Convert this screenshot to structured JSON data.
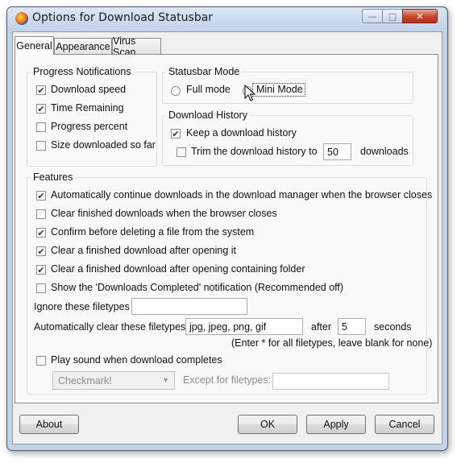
{
  "window": {
    "title": "Options for Download Statusbar",
    "caption_buttons": {
      "minimize": "—",
      "maximize": "□",
      "close": "✕"
    }
  },
  "tabs": [
    {
      "label": "General",
      "selected": true
    },
    {
      "label": "Appearance",
      "selected": false
    },
    {
      "label": "Virus Scan",
      "selected": false
    }
  ],
  "progress_notifications": {
    "legend": "Progress Notifications",
    "items": [
      {
        "label": "Download speed",
        "checked": true
      },
      {
        "label": "Time Remaining",
        "checked": true
      },
      {
        "label": "Progress percent",
        "checked": false
      },
      {
        "label": "Size downloaded so far",
        "checked": false
      }
    ]
  },
  "statusbar_mode": {
    "legend": "Statusbar Mode",
    "options": [
      {
        "label": "Full mode",
        "selected": false
      },
      {
        "label": "Mini Mode",
        "selected": true
      }
    ]
  },
  "download_history": {
    "legend": "Download History",
    "keep": {
      "label": "Keep a download history",
      "checked": true
    },
    "trim": {
      "label": "Trim the download history to",
      "checked": false,
      "value": "50",
      "suffix": "downloads"
    }
  },
  "features": {
    "legend": "Features",
    "items": [
      {
        "label": "Automatically continue downloads in the download manager when the browser closes",
        "checked": true
      },
      {
        "label": "Clear finished downloads when the browser closes",
        "checked": false
      },
      {
        "label": "Confirm before deleting a file from the system",
        "checked": true
      },
      {
        "label": "Clear a finished download after opening it",
        "checked": true
      },
      {
        "label": "Clear a finished download after opening containing folder",
        "checked": true
      },
      {
        "label": "Show the 'Downloads Completed' notification (Recommended off)",
        "checked": false
      }
    ],
    "ignore_filetypes": {
      "label": "Ignore these filetypes",
      "value": ""
    },
    "auto_clear": {
      "label": "Automatically clear these filetypes",
      "value": "jpg, jpeg, png, gif",
      "after_label": "after",
      "seconds_value": "5",
      "seconds_label": "seconds"
    },
    "hint": "(Enter * for all filetypes, leave blank for none)",
    "play_sound": {
      "label": "Play sound when download completes",
      "checked": false
    },
    "sound_select": {
      "value": "Checkmark!"
    },
    "except_filetypes": {
      "label": "Except for filetypes:",
      "value": ""
    }
  },
  "buttons": {
    "about": "About",
    "ok": "OK",
    "apply": "Apply",
    "cancel": "Cancel"
  },
  "check_mark": "✔"
}
